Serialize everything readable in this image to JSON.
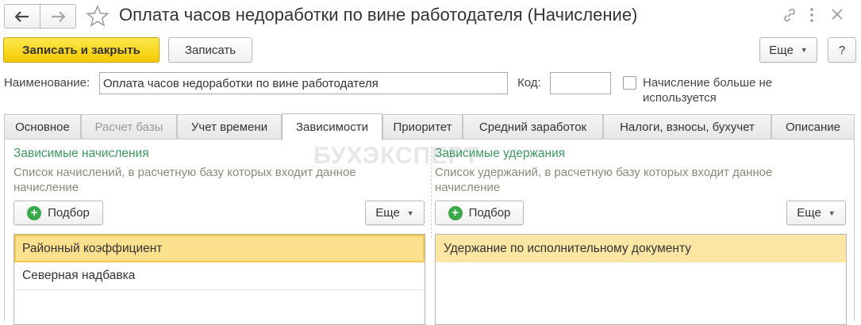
{
  "window": {
    "title": "Оплата часов недоработки по вине работодателя (Начисление)"
  },
  "toolbar": {
    "save_close_label": "Записать и закрыть",
    "save_label": "Записать",
    "more_label": "Еще",
    "help_label": "?"
  },
  "form": {
    "name_label": "Наименование:",
    "name_value": "Оплата часов недоработки по вине работодателя",
    "code_label": "Код:",
    "code_value": "",
    "not_used_label_line1": "Начисление больше не",
    "not_used_label_line2": "используется",
    "not_used_checked": false
  },
  "tabs": [
    {
      "label": "Основное",
      "state": "normal"
    },
    {
      "label": "Расчет базы",
      "state": "disabled"
    },
    {
      "label": "Учет времени",
      "state": "normal"
    },
    {
      "label": "Зависимости",
      "state": "active"
    },
    {
      "label": "Приоритет",
      "state": "normal"
    },
    {
      "label": "Средний заработок",
      "state": "normal"
    },
    {
      "label": "Налоги, взносы, бухучет",
      "state": "normal"
    },
    {
      "label": "Описание",
      "state": "normal"
    }
  ],
  "left_section": {
    "title": "Зависимые начисления",
    "description_line1": "Список начислений, в расчетную базу которых входит данное",
    "description_line2": "начисление",
    "pick_label": "Подбор",
    "more_label": "Еще",
    "rows": [
      "Районный коэффициент",
      "Северная надбавка"
    ]
  },
  "right_section": {
    "title": "Зависимые удержания",
    "description_line1": "Список удержаний, в расчетную базу которых входит данное",
    "description_line2": "начисление",
    "pick_label": "Подбор",
    "more_label": "Еще",
    "rows": [
      "Удержание по исполнительному документу"
    ]
  },
  "watermark": "БУХЭКСПЕРТ",
  "colors": {
    "primary_button": "#f5ca00",
    "section_title": "#3c9a5f",
    "selected_row": "#fbe08e",
    "plus_icon": "#3aa94a"
  }
}
